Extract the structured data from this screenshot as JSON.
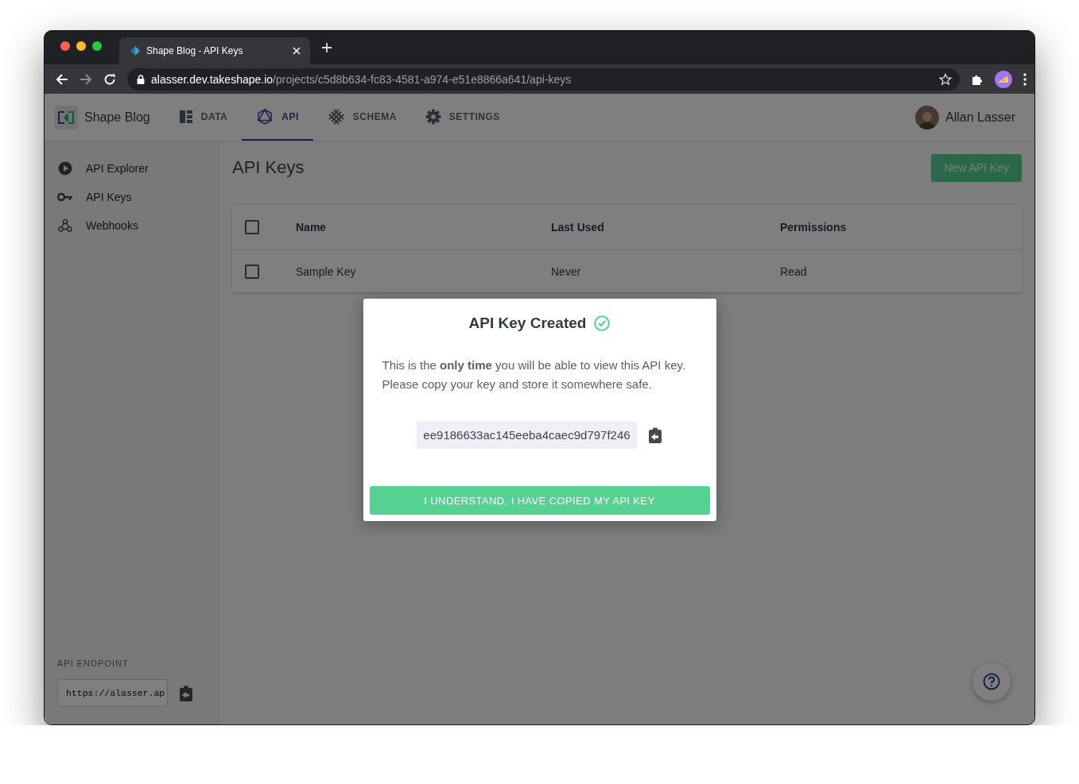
{
  "browser": {
    "tab_title": "Shape Blog - API Keys",
    "url_host": "alasser.dev.takeshape.io",
    "url_path": "/projects/c5d8b634-fc83-4581-a974-e51e8866a641/api-keys"
  },
  "header": {
    "project_name": "Shape Blog",
    "user_name": "Allan Lasser",
    "nav": [
      {
        "kind": "data",
        "label": "DATA",
        "selected": false
      },
      {
        "kind": "api",
        "label": "API",
        "selected": true
      },
      {
        "kind": "schema",
        "label": "SCHEMA",
        "selected": false
      },
      {
        "kind": "settings",
        "label": "SETTINGS",
        "selected": false
      }
    ]
  },
  "sidebar": {
    "items": [
      {
        "kind": "explorer",
        "label": "API Explorer"
      },
      {
        "kind": "keys",
        "label": "API Keys"
      },
      {
        "kind": "webhooks",
        "label": "Webhooks"
      }
    ],
    "endpoint_label": "API ENDPOINT",
    "endpoint_value": "https://alasser.ap"
  },
  "page": {
    "title": "API Keys",
    "new_button": "New API Key"
  },
  "table": {
    "header_checked": false,
    "columns": [
      "Name",
      "Last Used",
      "Permissions"
    ],
    "rows": [
      {
        "checked": false,
        "cells": [
          "Sample Key",
          "Never",
          "Read"
        ]
      }
    ]
  },
  "modal": {
    "title": "API Key Created",
    "body": "This is the **only time** you will be able to view this API key. Please copy your key and store it somewhere safe.",
    "api_key": "ee9186633ac145eeba4caec9d797f246",
    "confirm_button": "I UNDERSTAND, I HAVE COPIED MY API KEY"
  }
}
